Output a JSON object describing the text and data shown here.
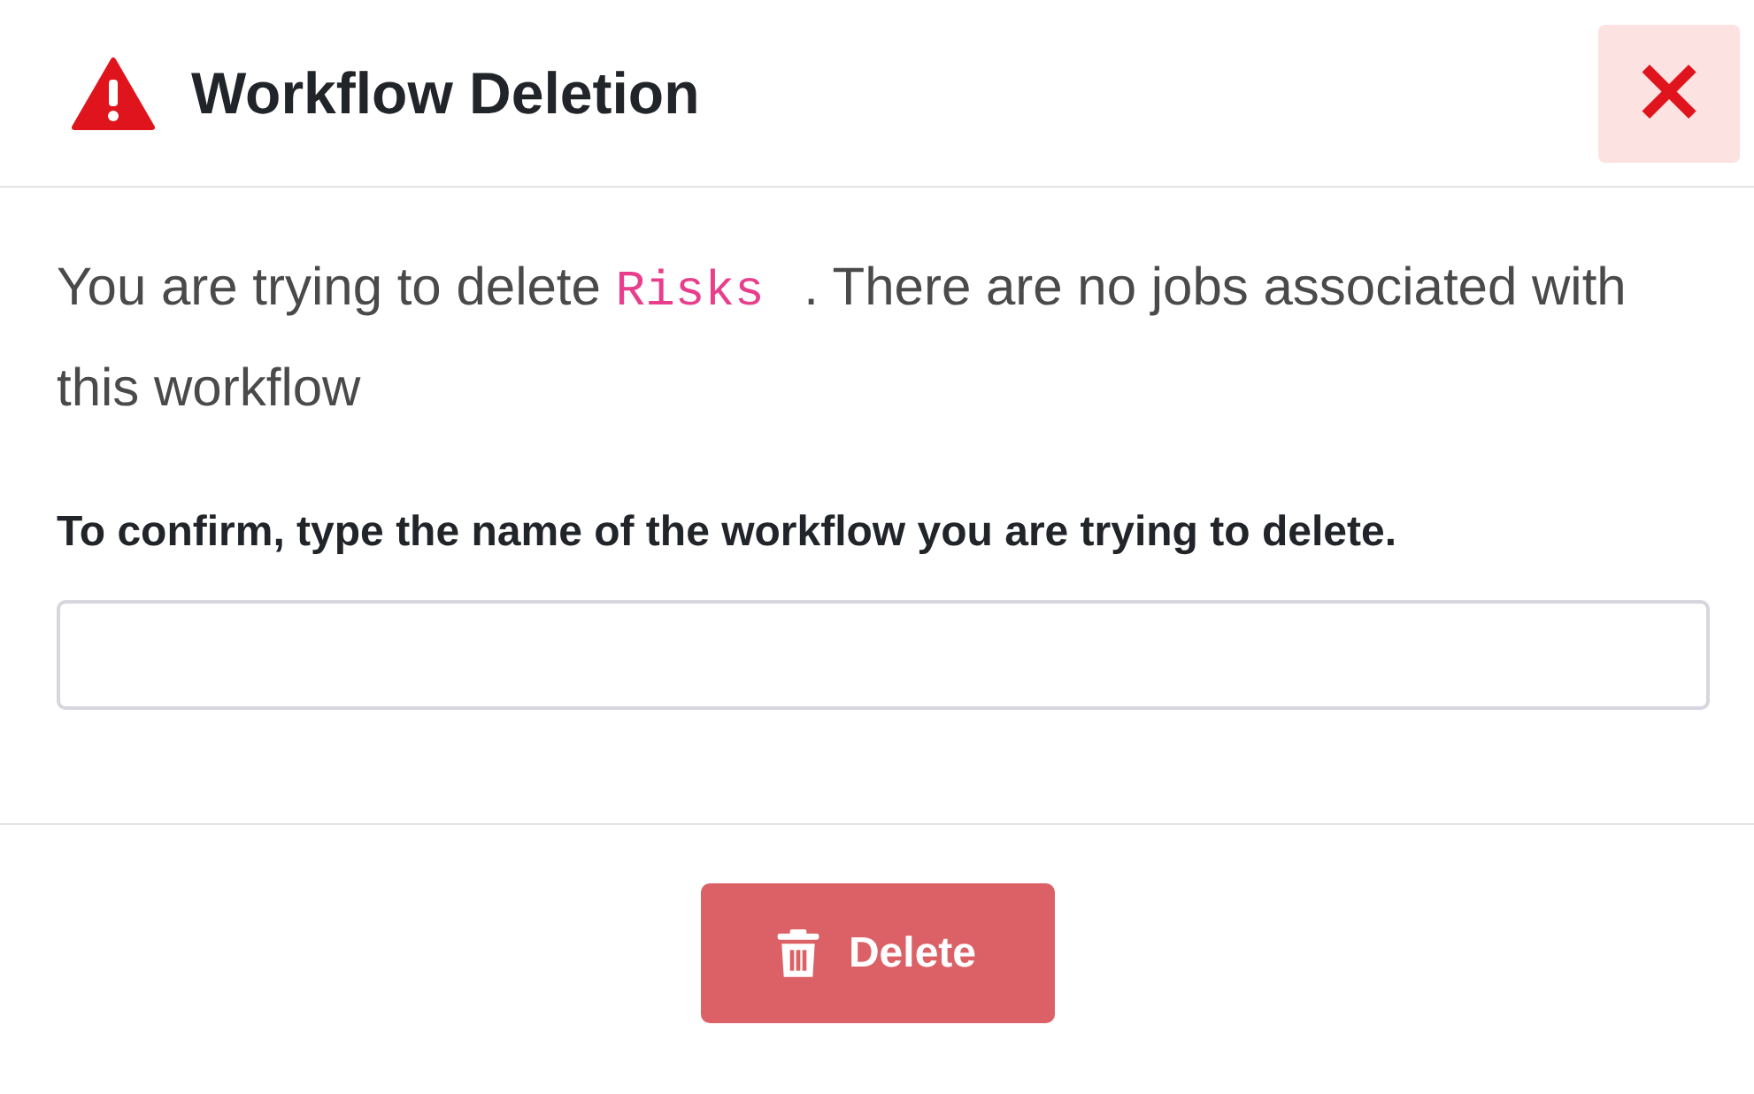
{
  "dialog": {
    "title": "Workflow Deletion",
    "close_label": "×"
  },
  "message": {
    "before": "You are trying to delete ",
    "name": "Risks",
    "after": " . There are no jobs associated with this workflow"
  },
  "confirm": {
    "label": "To confirm, type the name of the workflow you are trying to delete."
  },
  "delete_button": {
    "label": "Delete",
    "disabled": true
  }
}
